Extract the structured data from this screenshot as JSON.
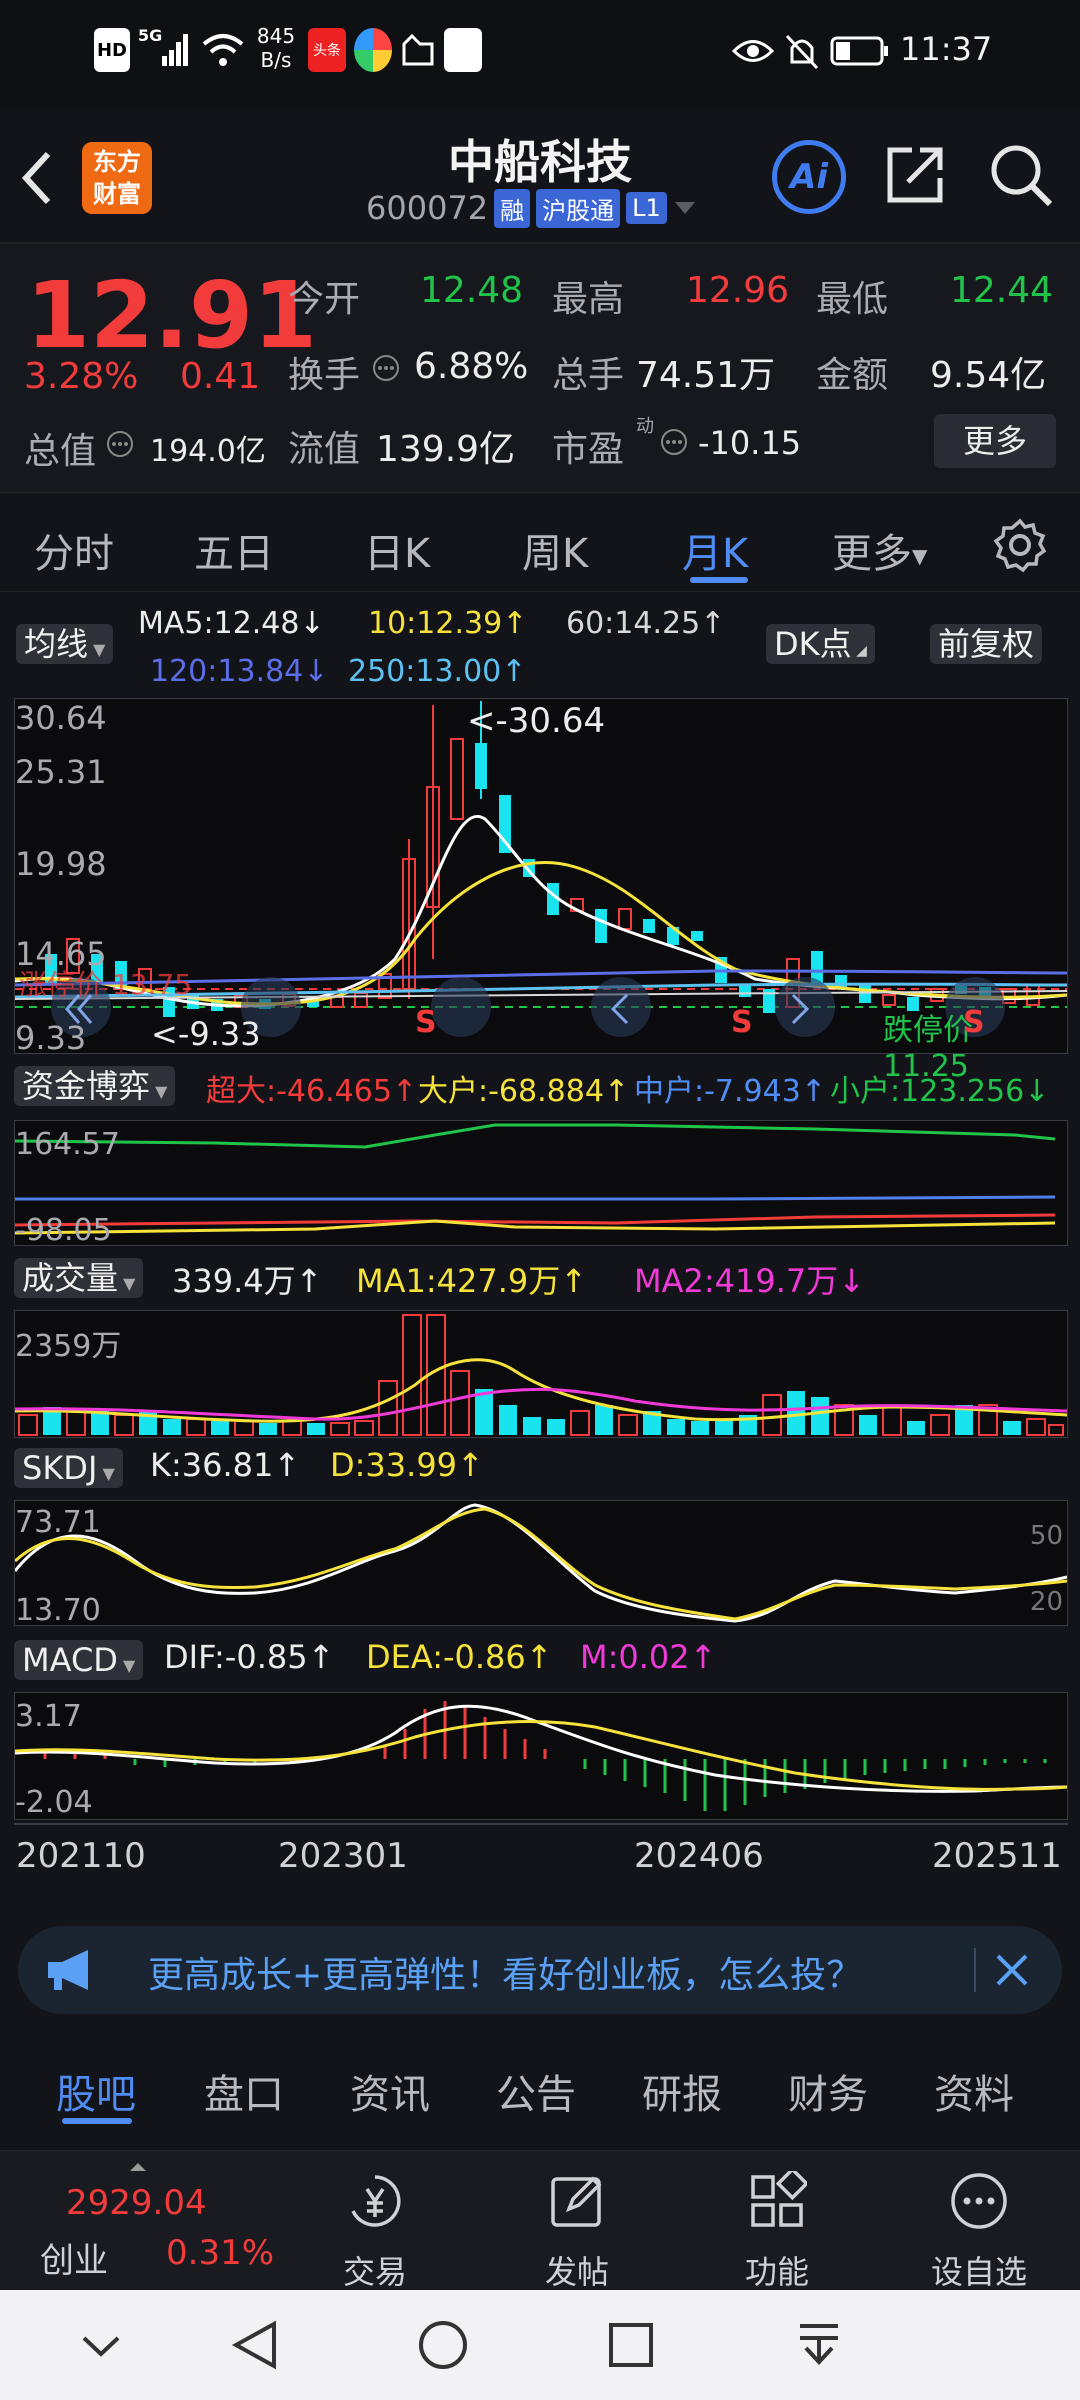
{
  "status_bar": {
    "time": "11:37",
    "net_speed_value": "845",
    "net_speed_unit": "B/s",
    "signal_label": "5G",
    "hd_label": "HD",
    "news_badge": "头条"
  },
  "header": {
    "logo_line1": "东方",
    "logo_line2": "财富",
    "stock_name": "中船科技",
    "stock_code": "600072",
    "tag_margin": "融",
    "tag_connect": "沪股通",
    "tag_level": "L1",
    "ai_label": "Ai"
  },
  "quote": {
    "price": "12.91",
    "change_pct": "3.28%",
    "change_abs": "0.41",
    "open_label": "今开",
    "open_value": "12.48",
    "high_label": "最高",
    "high_value": "12.96",
    "low_label": "最低",
    "low_value": "12.44",
    "turnover_label": "换手",
    "turnover_value": "6.88%",
    "volume_label": "总手",
    "volume_value": "74.51万",
    "amount_label": "金额",
    "amount_value": "9.54亿",
    "mktcap_label": "总值",
    "mktcap_value": "194.0亿",
    "float_label": "流值",
    "float_value": "139.9亿",
    "pe_label": "市盈",
    "pe_sup": "动",
    "pe_value": "-10.15",
    "more_label": "更多"
  },
  "period_tabs": [
    {
      "label": "分时",
      "active": false
    },
    {
      "label": "五日",
      "active": false
    },
    {
      "label": "日K",
      "active": false
    },
    {
      "label": "周K",
      "active": false
    },
    {
      "label": "月K",
      "active": true
    },
    {
      "label": "更多",
      "active": false
    }
  ],
  "kline": {
    "ma_button": "均线",
    "ma5": "MA5:12.48↓",
    "ma10": "10:12.39↑",
    "ma60": "60:14.25↑",
    "ma120": "120:13.84↓",
    "ma250": "250:13.00↑",
    "dk_button": "DK点",
    "adjust_button": "前复权",
    "y_labels": [
      "30.64",
      "25.31",
      "19.98",
      "14.65",
      "9.33"
    ],
    "max_label": "<-30.64",
    "min_label": "<-9.33",
    "limit_down_label": "跌停价",
    "limit_down_value": "11.25",
    "limit_up_partial": "涨停价",
    "limit_up_value": "13.75",
    "signal_s": "S"
  },
  "capital": {
    "button": "资金博弈",
    "super_large": "超大:-46.465↑",
    "large": "大户:-68.884↑",
    "medium": "中户:-7.943↑",
    "small": "小户:123.256↓",
    "y_top": "164.57",
    "y_bottom": "-98.05"
  },
  "volume": {
    "button": "成交量",
    "value": "339.4万↑",
    "ma1": "MA1:427.9万↑",
    "ma2": "MA2:419.7万↓",
    "y_top": "2359万"
  },
  "skdj": {
    "button": "SKDJ",
    "k": "K:36.81↑",
    "d": "D:33.99↑",
    "y_top": "73.71",
    "y_bottom": "13.70",
    "right_50": "50",
    "right_20": "20"
  },
  "macd": {
    "button": "MACD",
    "dif": "DIF:-0.85↑",
    "dea": "DEA:-0.86↑",
    "m": "M:0.02↑",
    "y_top": "3.17",
    "y_bottom": "-2.04"
  },
  "x_axis": [
    "202110",
    "202301",
    "202406",
    "202511"
  ],
  "banner": {
    "text": "更高成长+更高弹性！看好创业板，怎么投？"
  },
  "info_tabs": [
    {
      "label": "股吧",
      "active": true
    },
    {
      "label": "盘口",
      "active": false
    },
    {
      "label": "资讯",
      "active": false
    },
    {
      "label": "公告",
      "active": false
    },
    {
      "label": "研报",
      "active": false
    },
    {
      "label": "财务",
      "active": false
    },
    {
      "label": "资料",
      "active": false
    }
  ],
  "bottom_nav": {
    "index_value": "2929.04",
    "index_name": "创业",
    "index_change": "0.31%",
    "trade": "交易",
    "post": "发帖",
    "function": "功能",
    "watchlist": "设自选"
  },
  "colors": {
    "up": "#f23b3b",
    "down": "#21c44a",
    "accent": "#4f8cf4",
    "candle_down": "#19e3ef"
  }
}
